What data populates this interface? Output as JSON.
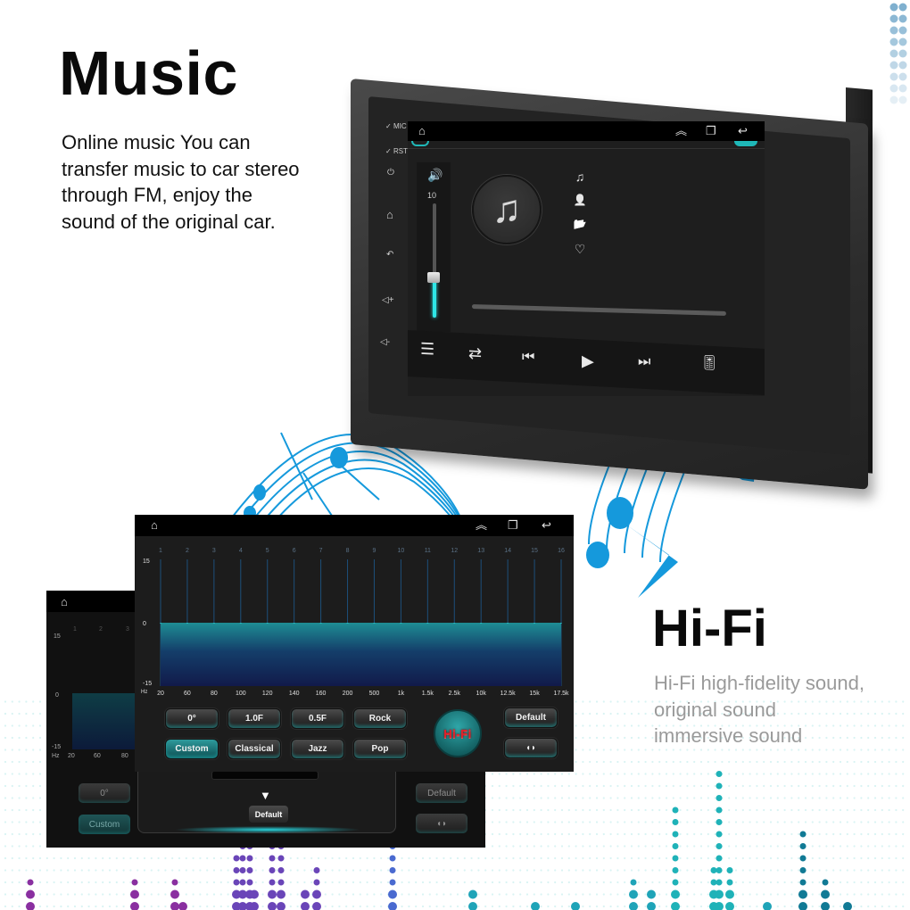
{
  "music_section": {
    "title": "Music",
    "description": "Online music You can transfer music to car stereo through FM, enjoy the sound of the original car."
  },
  "hifi_section": {
    "title": "Hi-Fi",
    "description": "Hi-Fi high-fidelity sound, original sound immersive sound"
  },
  "head_unit": {
    "side_panel": {
      "mic_label": "MIC",
      "rst_label": "RST",
      "buttons": [
        {
          "icon": "power-icon",
          "glyph": "⏻"
        },
        {
          "icon": "home-icon",
          "glyph": "⌂"
        },
        {
          "icon": "back-icon",
          "glyph": "↶"
        },
        {
          "icon": "volume-up-icon",
          "glyph": "◁+"
        },
        {
          "icon": "volume-down-icon",
          "glyph": "◁-"
        }
      ]
    },
    "nav_bar": {
      "home_glyph": "⌂",
      "collapse_glyph": "︽",
      "recents_glyph": "❐",
      "back_glyph": "↩"
    },
    "player": {
      "volume_icon": "🔊",
      "volume_level": "10",
      "volume_fraction": 0.35,
      "album_glyph": "♫",
      "meta_icons": [
        {
          "name": "song-icon",
          "glyph": "♫"
        },
        {
          "name": "artist-icon",
          "glyph": "👤"
        },
        {
          "name": "folder-icon",
          "glyph": "📂"
        },
        {
          "name": "favorite-icon",
          "glyph": "♡"
        }
      ],
      "progress_fraction": 0,
      "controls": [
        {
          "name": "playlist-button",
          "glyph": "☰"
        },
        {
          "name": "repeat-button",
          "glyph": "⇄"
        },
        {
          "name": "previous-button",
          "glyph": "⏮"
        },
        {
          "name": "play-button",
          "glyph": "▶"
        },
        {
          "name": "next-button",
          "glyph": "⏭"
        },
        {
          "name": "equalizer-button",
          "glyph": "🎚"
        }
      ]
    }
  },
  "eq_back": {
    "y_labels": [
      "15",
      "0",
      "-15"
    ],
    "x_unit": "Hz",
    "x_labels": [
      "20",
      "60",
      "80"
    ],
    "band_labels": [
      "1",
      "2",
      "3"
    ],
    "buttons": {
      "zero_label": "0°",
      "custom_label": "Custom",
      "default_label": "Default",
      "balance_glyph": "◖◗"
    },
    "dropdown": {
      "arrow_glyph": "▼",
      "default_label": "Default"
    }
  },
  "eq_front": {
    "nav_bar": {
      "home_glyph": "⌂",
      "collapse_glyph": "︽",
      "recents_glyph": "❐",
      "back_glyph": "↩"
    },
    "presets_row1": [
      "0°",
      "1.0F",
      "0.5F",
      "Rock"
    ],
    "presets_row2": [
      "Custom",
      "Classical",
      "Jazz",
      "Pop"
    ],
    "active_preset": "Custom",
    "hifi_label": "Hi-Fi",
    "default_label": "Default",
    "balance_glyph": "◖◗"
  },
  "chart_data": {
    "type": "bar",
    "title": "",
    "xlabel": "Hz",
    "ylabel": "",
    "ylim": [
      -15,
      15
    ],
    "y_ticks": [
      "15",
      "0",
      "-15"
    ],
    "band_numbers": [
      "1",
      "2",
      "3",
      "4",
      "5",
      "6",
      "7",
      "8",
      "9",
      "10",
      "11",
      "12",
      "13",
      "14",
      "15",
      "16"
    ],
    "categories": [
      "20",
      "60",
      "80",
      "100",
      "120",
      "140",
      "160",
      "200",
      "500",
      "1k",
      "1.5k",
      "2.5k",
      "10k",
      "12.5k",
      "15k",
      "17.5k"
    ],
    "values": [
      0,
      0,
      0,
      0,
      0,
      0,
      0,
      0,
      0,
      0,
      0,
      0,
      0,
      0,
      0,
      0
    ],
    "grid": true,
    "legend": "none"
  },
  "colors": {
    "accent_teal": "#2ee6e6",
    "note_blue": "#1599dc",
    "hifi_red": "#e3212b"
  }
}
